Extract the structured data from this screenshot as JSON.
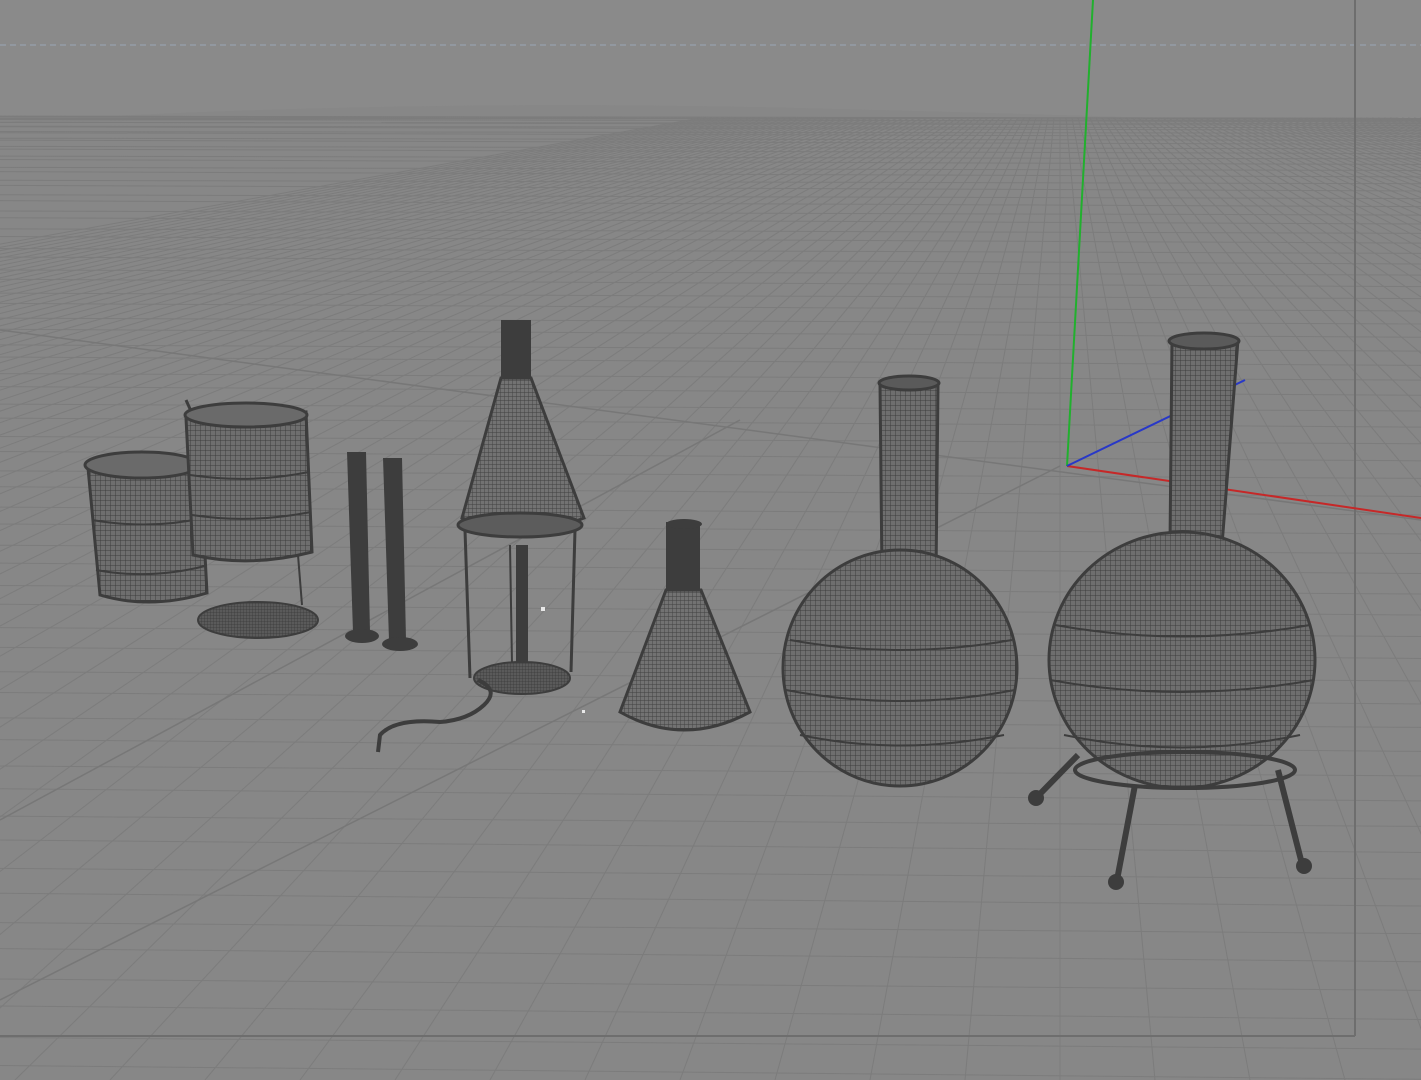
{
  "viewport": {
    "view": "perspective",
    "shading": "wireframe",
    "grid": true,
    "colors": {
      "background": "#8a8a8a",
      "grid_line": "#7c7c7c",
      "grid_major": "#777777",
      "wire": "#3d3d3d",
      "axis_x": "#c62828",
      "axis_y": "#21b02e",
      "axis_z": "#2838c8",
      "safe_frame": "#9aa6b6"
    },
    "objects": [
      {
        "name": "beaker-small",
        "type": "beaker"
      },
      {
        "name": "beaker-large",
        "type": "beaker"
      },
      {
        "name": "test-tube-1",
        "type": "test-tube"
      },
      {
        "name": "test-tube-2",
        "type": "test-tube"
      },
      {
        "name": "bunsen-burner",
        "type": "burner"
      },
      {
        "name": "erlenmeyer-flask",
        "type": "erlenmeyer-flask"
      },
      {
        "name": "round-bottom-flask",
        "type": "round-bottom-flask"
      },
      {
        "name": "round-flask-on-stand",
        "type": "round-bottom-flask"
      }
    ],
    "icons": {
      "world_axis": "axis-gizmo-icon"
    }
  }
}
